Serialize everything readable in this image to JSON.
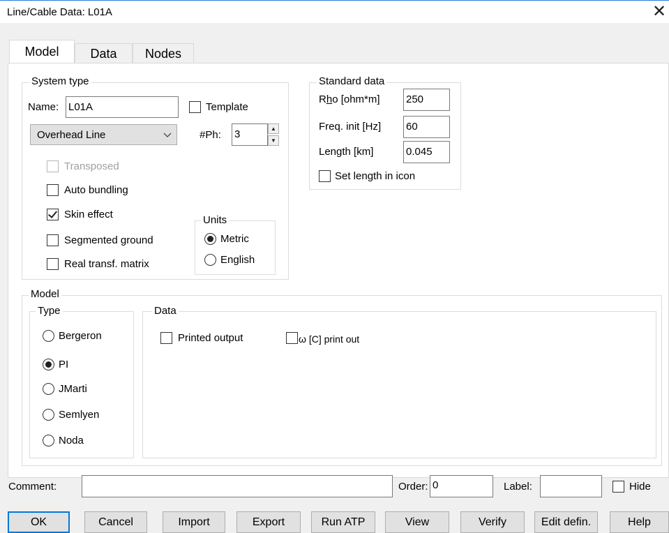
{
  "window": {
    "title": "Line/Cable Data: L01A",
    "close_glyph": "✕"
  },
  "tabs": [
    {
      "label": "Model",
      "active": true
    },
    {
      "label": "Data",
      "active": false
    },
    {
      "label": "Nodes",
      "active": false
    }
  ],
  "system_type": {
    "legend": "System type",
    "name_label": "Name:",
    "name_value": "L01A",
    "template_label": "Template",
    "template_checked": false,
    "line_type": "Overhead Line",
    "phases_label": "#Ph:",
    "phases_value": "3",
    "transposed_label": "Transposed",
    "auto_bundling_label": "Auto bundling",
    "skin_effect_label": "Skin effect",
    "segmented_ground_label": "Segmented ground",
    "real_transf_label": "Real transf. matrix",
    "units": {
      "legend": "Units",
      "metric_label": "Metric",
      "english_label": "English",
      "selected": "Metric"
    }
  },
  "standard_data": {
    "legend": "Standard data",
    "rho_label_pre": "R",
    "rho_label_u": "h",
    "rho_label_post": "o [ohm*m]",
    "rho_value": "250",
    "freq_label": "Freq. init [Hz]",
    "freq_value": "60",
    "length_label": "Length [km]",
    "length_value": "0.045",
    "set_length_label": "Set length in icon"
  },
  "model": {
    "legend": "Model",
    "type": {
      "legend": "Type",
      "options": [
        "Bergeron",
        "PI",
        "JMarti",
        "Semlyen",
        "Noda"
      ],
      "selected": "PI"
    },
    "data": {
      "legend": "Data",
      "printed_output_label": "Printed output",
      "omega_symbol": "ω",
      "omega_label": " [C] print out"
    }
  },
  "footer": {
    "comment_label": "Comment:",
    "comment_value": "",
    "order_label": "Order:",
    "order_value": "0",
    "label_label": "Label:",
    "label_value": "",
    "hide_label": "Hide"
  },
  "buttons": [
    "OK",
    "Cancel",
    "Import",
    "Export",
    "Run ATP",
    "View",
    "Verify",
    "Edit defin.",
    "Help"
  ],
  "colors": {
    "accent": "#0078d7",
    "dialog_bg": "#f0f0f0",
    "button_bg": "#e1e1e1"
  }
}
